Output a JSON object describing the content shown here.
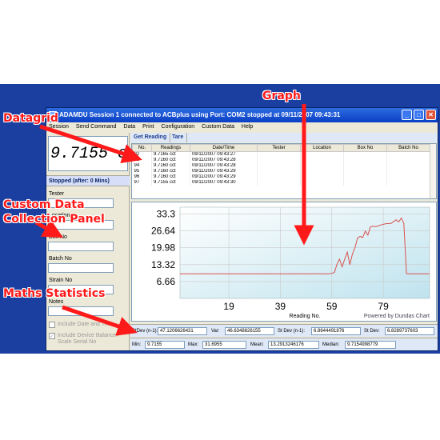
{
  "window": {
    "title": "ADAMDU Session 1 connected to ACBplus using Port: COM2 stopped at 09/11/2007 09:43:31",
    "min": "_",
    "max": "□",
    "close": "✕"
  },
  "menu": [
    "Session",
    "Send Command",
    "Data",
    "Print",
    "Configuration",
    "Custom Data",
    "Help"
  ],
  "left": {
    "lcd": "9.7155 cct",
    "status": "Stopped (after: 0 Mins)",
    "fields": [
      {
        "label": "Tester"
      },
      {
        "label": "Location"
      },
      {
        "label": "Box No"
      },
      {
        "label": "Batch No"
      },
      {
        "label": "Strain No"
      },
      {
        "label": "Notes"
      }
    ],
    "checks": [
      {
        "label": "Include Date and Time"
      },
      {
        "label": "Include Device Balance / Scale Serial No"
      }
    ]
  },
  "tabs": {
    "get_reading": "Get Reading",
    "tare": "Tare"
  },
  "grid": {
    "columns": [
      "No.",
      "Readings",
      "Date/Time",
      "Tester",
      "Location",
      "Box No",
      "Batch No"
    ],
    "rows": [
      [
        "92",
        "9.7165 cct",
        "09/11/2007 09:43:27"
      ],
      [
        "93",
        "9.7160 cct",
        "09/11/2007 09:43:28"
      ],
      [
        "94",
        "9.7160 cct",
        "09/11/2007 09:43:28"
      ],
      [
        "95",
        "9.7160 cct",
        "09/11/2007 09:43:29"
      ],
      [
        "96",
        "9.7160 cct",
        "09/11/2007 09:43:29"
      ],
      [
        "97",
        "9.7155 cct",
        "09/11/2007 09:43:30"
      ]
    ]
  },
  "chart_data": {
    "type": "line",
    "title": "",
    "xlabel": "Reading No.",
    "ylabel": "",
    "xlim": [
      0,
      97
    ],
    "ylim": [
      0,
      36
    ],
    "yticks": [
      6.66,
      13.32,
      19.98,
      26.64,
      33.3
    ],
    "xticks": [
      19,
      39,
      59,
      79
    ],
    "grid": true,
    "footer": "Powered by Dundas Chart",
    "series": [
      {
        "color": "#d9534f",
        "x": [
          0,
          57,
          58,
          60,
          61,
          62,
          63,
          64,
          65,
          66,
          67,
          68,
          69,
          70,
          71,
          72,
          73,
          74,
          75,
          76,
          77,
          78,
          80,
          82,
          84,
          85,
          86,
          87,
          88,
          89,
          90,
          97
        ],
        "y": [
          9.7,
          9.7,
          9.7,
          10.2,
          13.5,
          15.5,
          12.5,
          15.5,
          18.3,
          13.3,
          17.5,
          20.0,
          23.8,
          24.5,
          24.0,
          26.6,
          25.0,
          28.2,
          28.5,
          28.3,
          28.6,
          29.0,
          29.5,
          29.6,
          31.0,
          30.2,
          31.7,
          29.7,
          9.8,
          9.7,
          9.7,
          9.7
        ]
      }
    ]
  },
  "stats": {
    "row1": [
      {
        "label": "StDev (n-1):",
        "value": "47.1206626431"
      },
      {
        "label": "Var:",
        "value": "46.6348826155"
      },
      {
        "label": "St Dev (n-1):",
        "value": "6.8644491876"
      },
      {
        "label": "St Dev:",
        "value": "6.8289737603"
      }
    ],
    "row2": [
      {
        "label": "Min:",
        "value": "9.7155"
      },
      {
        "label": "Max:",
        "value": "31.6955"
      },
      {
        "label": "Mean:",
        "value": "13.2913246176"
      },
      {
        "label": "Median:",
        "value": "9.7154998779"
      }
    ]
  },
  "annotations": {
    "datagrid": "Datagrid",
    "graph": "Graph",
    "custom_data": "Custom Data",
    "collection_panel": "Collection Panel",
    "maths_statistics": "Maths Statistics"
  },
  "colors": {
    "background": "#1a3fa0",
    "annotation": "#ff1a1a",
    "series": "#d9534f"
  }
}
